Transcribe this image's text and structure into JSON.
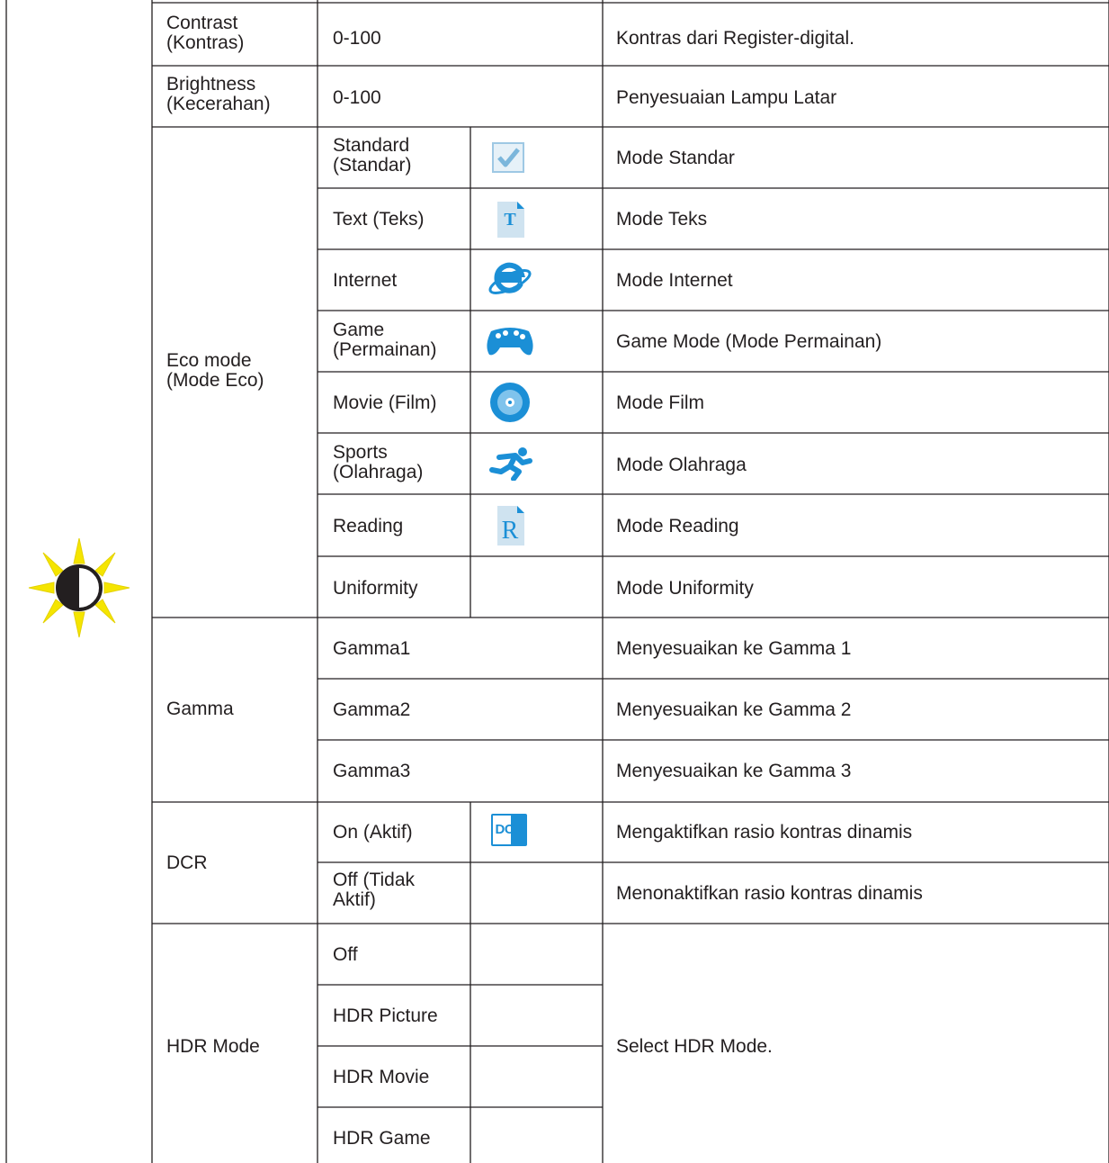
{
  "rows": {
    "contrast": {
      "label": "Contrast\n(Kontras)",
      "value": "0-100",
      "desc": "Kontras dari Register-digital."
    },
    "brightness": {
      "label": "Brightness\n(Kecerahan)",
      "value": "0-100",
      "desc": "Penyesuaian Lampu Latar"
    },
    "eco": {
      "label": "Eco mode\n(Mode Eco)",
      "options": [
        {
          "label": "Standard\n(Standar)",
          "icon": "check-icon",
          "desc": "Mode Standar"
        },
        {
          "label": "Text (Teks)",
          "icon": "text-t-icon",
          "desc": "Mode Teks"
        },
        {
          "label": "Internet",
          "icon": "internet-e-icon",
          "desc": "Mode Internet"
        },
        {
          "label": "Game\n(Permainan)",
          "icon": "gamepad-icon",
          "desc": "Game Mode (Mode Permainan)"
        },
        {
          "label": "Movie (Film)",
          "icon": "disc-icon",
          "desc": "Mode Film"
        },
        {
          "label": "Sports\n(Olahraga)",
          "icon": "runner-icon",
          "desc": "Mode Olahraga"
        },
        {
          "label": "Reading",
          "icon": "reading-r-icon",
          "desc": "Mode Reading"
        },
        {
          "label": "Uniformity",
          "icon": "",
          "desc": "Mode Uniformity"
        }
      ]
    },
    "gamma": {
      "label": "Gamma",
      "options": [
        {
          "label": "Gamma1",
          "desc": "Menyesuaikan ke Gamma 1"
        },
        {
          "label": "Gamma2",
          "desc": "Menyesuaikan ke Gamma 2"
        },
        {
          "label": "Gamma3",
          "desc": "Menyesuaikan ke Gamma 3"
        }
      ]
    },
    "dcr": {
      "label": "DCR",
      "options": [
        {
          "label": "On (Aktif)",
          "icon": "dcr-icon",
          "icon_text": "DCR",
          "desc": "Mengaktifkan rasio kontras dinamis"
        },
        {
          "label": "Off (Tidak\nAktif)",
          "desc": "Menonaktifkan rasio kontras dinamis"
        }
      ]
    },
    "hdr": {
      "label": "HDR Mode",
      "options": [
        {
          "label": "Off"
        },
        {
          "label": "HDR Picture"
        },
        {
          "label": "HDR Movie"
        },
        {
          "label": "HDR Game"
        }
      ],
      "desc": "Select HDR Mode."
    }
  },
  "section_icon": "luminance-sun-icon",
  "colors": {
    "line": "#231f20",
    "icon_blue": "#1b8fd6",
    "icon_light": "#cfe3f0",
    "sun_yellow": "#f5e500"
  }
}
